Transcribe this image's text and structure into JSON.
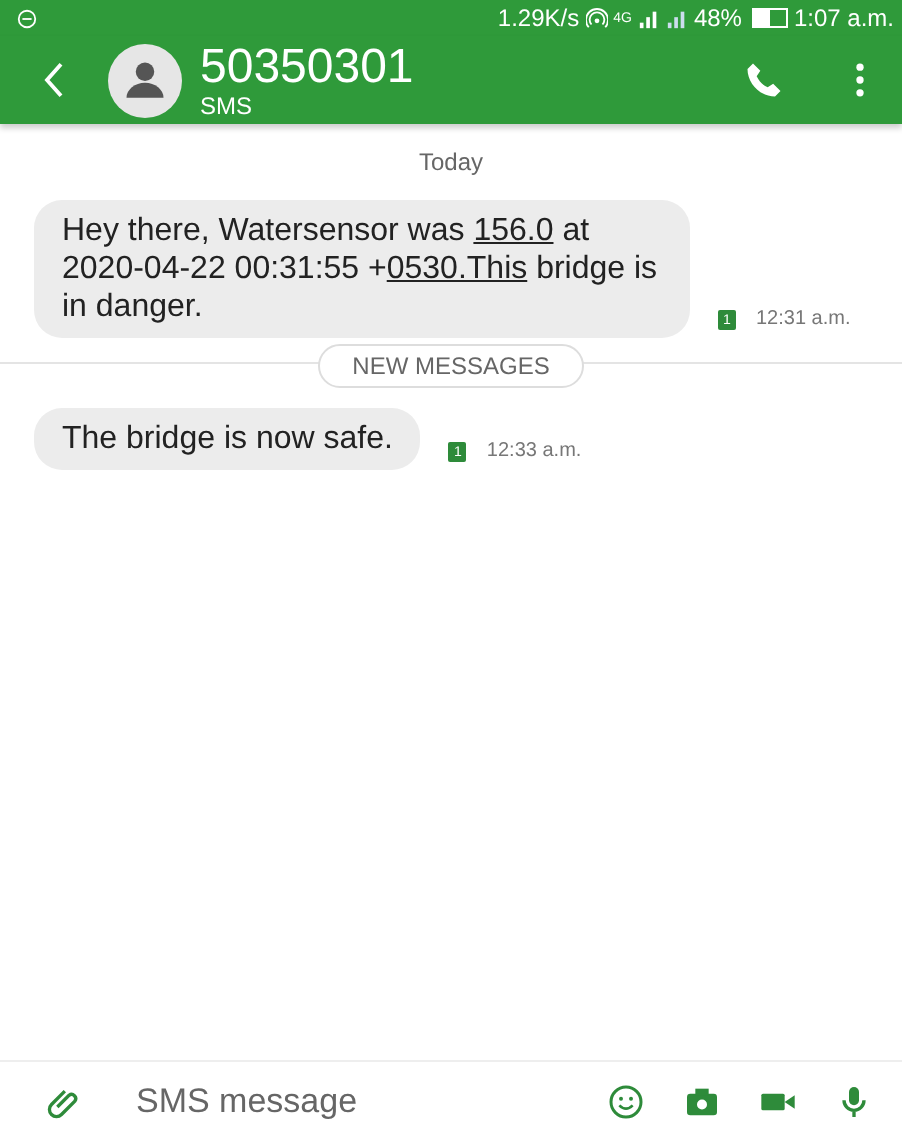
{
  "status_bar": {
    "speed": "1.29K/s",
    "network": "4G",
    "battery": "48%",
    "time": "1:07 a.m."
  },
  "header": {
    "contact": "50350301",
    "subtitle": "SMS"
  },
  "day_label": "Today",
  "messages": [
    {
      "parts": [
        {
          "text": "Hey there, Watersensor was ",
          "link": false
        },
        {
          "text": "156.0",
          "link": true
        },
        {
          "text": " at 2020-04-22 00:31:55 +",
          "link": false
        },
        {
          "text": "0530.This",
          "link": true
        },
        {
          "text": " bridge is in danger.",
          "link": false
        }
      ],
      "sim": "1",
      "time": "12:31 a.m."
    },
    {
      "divider": "NEW MESSAGES"
    },
    {
      "parts": [
        {
          "text": "The bridge is now safe.",
          "link": false
        }
      ],
      "sim": "1",
      "time": "12:33 a.m."
    }
  ],
  "composer": {
    "placeholder": "SMS message"
  }
}
